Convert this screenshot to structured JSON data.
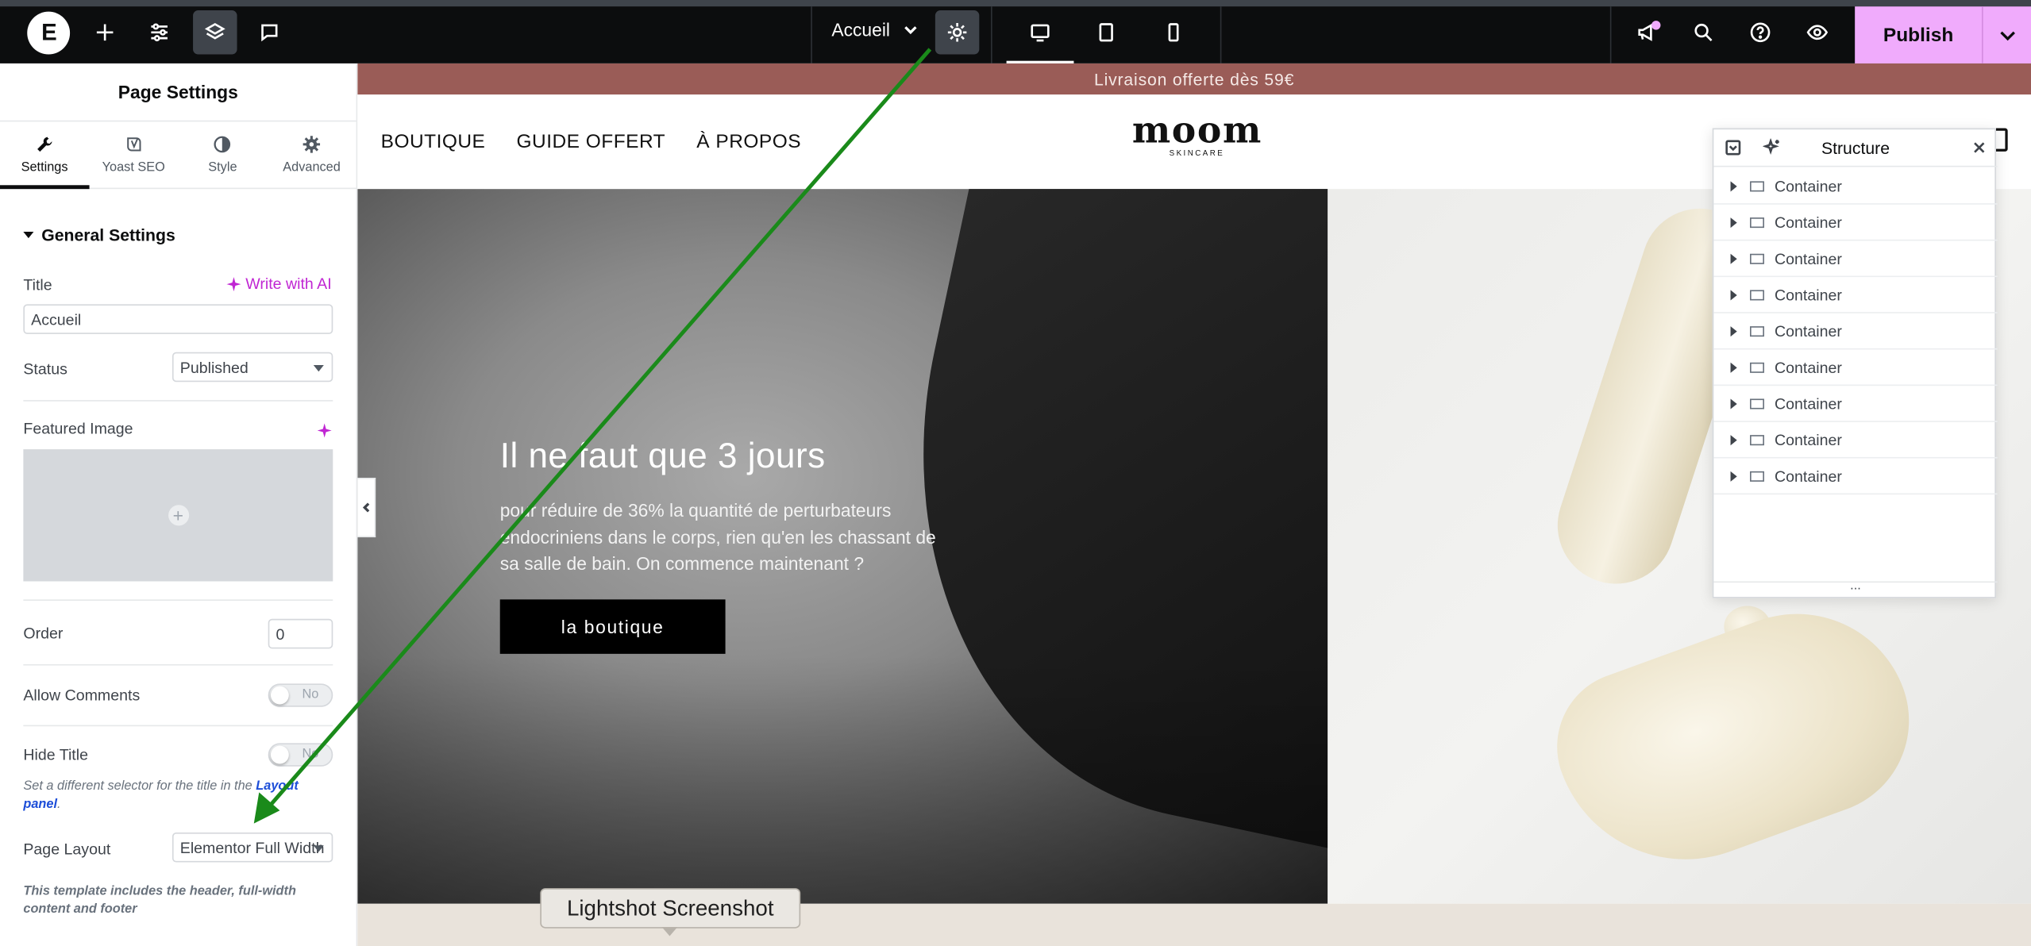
{
  "topbar": {
    "logo_text": "E",
    "add_icon": "plus-icon",
    "settings_icon": "sliders-icon",
    "structure_icon": "layers-icon",
    "notes_icon": "comment-icon",
    "page_name": "Accueil",
    "page_settings_icon": "gear-icon",
    "devices": [
      "desktop-icon",
      "tablet-icon",
      "mobile-icon"
    ],
    "whats_new_icon": "megaphone-icon",
    "search_icon": "search-icon",
    "help_icon": "help-icon",
    "preview_icon": "eye-icon",
    "publish_label": "Publish",
    "accent": "#f0abfc"
  },
  "panel": {
    "title": "Page Settings",
    "tabs": [
      {
        "label": "Settings",
        "icon": "wrench-icon",
        "active": true
      },
      {
        "label": "Yoast SEO",
        "icon": "yoast-icon",
        "active": false
      },
      {
        "label": "Style",
        "icon": "contrast-icon",
        "active": false
      },
      {
        "label": "Advanced",
        "icon": "gear-icon",
        "active": false
      }
    ],
    "section_title": "General Settings",
    "title_label": "Title",
    "write_ai": "Write with AI",
    "title_value": "Accueil",
    "status_label": "Status",
    "status_value": "Published",
    "featured_label": "Featured Image",
    "order_label": "Order",
    "order_value": "0",
    "comments_label": "Allow Comments",
    "comments_value": "No",
    "hide_title_label": "Hide Title",
    "hide_title_value": "No",
    "hide_title_help_pre": "Set a different selector for the title in the ",
    "hide_title_help_link": "Layout panel",
    "hide_title_help_post": ".",
    "layout_label": "Page Layout",
    "layout_value": "Elementor Full Width",
    "layout_help": "This template includes the header, full-width content and footer"
  },
  "canvas": {
    "promo": "Livraison offerte dès 59€",
    "nav": [
      "BOUTIQUE",
      "GUIDE OFFERT",
      "À PROPOS"
    ],
    "brand_name": "moom",
    "brand_sub": "SKINCARE",
    "hero_title": "Il ne faut que 3 jours",
    "hero_body": "pour réduire de 36% la quantité de perturbateurs endocriniens dans le corps, rien qu'en les chassant de sa salle de bain. On commence maintenant ?",
    "hero_cta": "la boutique",
    "promo_color": "#9a5c57"
  },
  "structure": {
    "title": "Structure",
    "items": [
      "Container",
      "Container",
      "Container",
      "Container",
      "Container",
      "Container",
      "Container",
      "Container",
      "Container"
    ],
    "footer": "..."
  },
  "overlay": {
    "tooltip": "Lightshot Screenshot",
    "arrow_color": "#1a8a1a"
  }
}
